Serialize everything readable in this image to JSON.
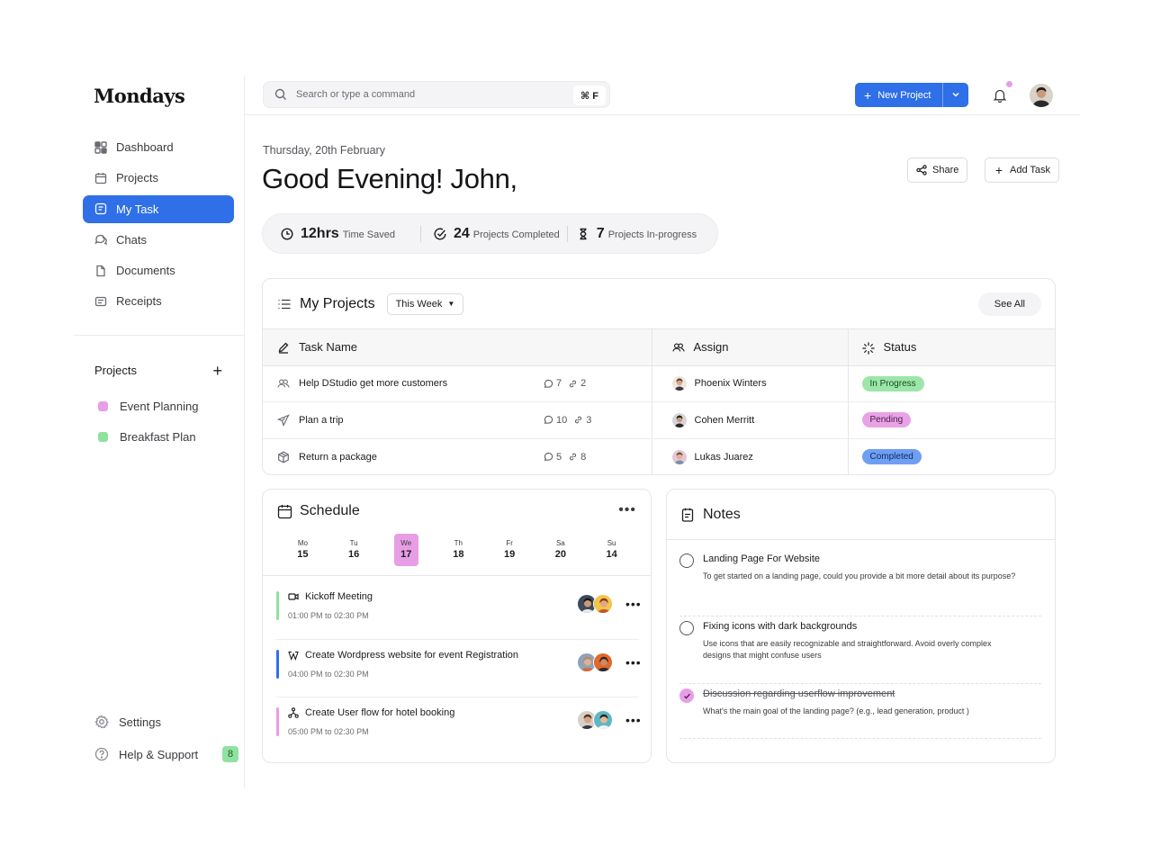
{
  "app": {
    "logo": "Mondays"
  },
  "sidebar": {
    "nav": [
      {
        "label": "Dashboard",
        "icon": "dashboard-icon"
      },
      {
        "label": "Projects",
        "icon": "calendar-icon"
      },
      {
        "label": "My Task",
        "icon": "task-icon",
        "active": true
      },
      {
        "label": "Chats",
        "icon": "chat-icon"
      },
      {
        "label": "Documents",
        "icon": "document-icon"
      },
      {
        "label": "Receipts",
        "icon": "receipt-icon"
      }
    ],
    "projects_heading": "Projects",
    "projects": [
      {
        "label": "Event Planning",
        "color": "#e79ee6"
      },
      {
        "label": "Breakfast Plan",
        "color": "#8fe2a0"
      }
    ],
    "settings_label": "Settings",
    "help_label": "Help & Support",
    "help_count": "8"
  },
  "topbar": {
    "search_placeholder": "Search or type a command",
    "search_shortcut": "⌘ F",
    "new_project_label": "New Project"
  },
  "header": {
    "date": "Thursday, 20th February",
    "greeting": "Good Evening! John,",
    "share_label": "Share",
    "add_task_label": "Add Task"
  },
  "stats": [
    {
      "value": "12hrs",
      "label": "Time Saved",
      "icon": "clock-icon"
    },
    {
      "value": "24",
      "label": "Projects Completed",
      "icon": "check-circle-icon"
    },
    {
      "value": "7",
      "label": "Projects In-progress",
      "icon": "hourglass-icon"
    }
  ],
  "my_projects": {
    "title": "My Projects",
    "range": "This Week",
    "see_all": "See All",
    "columns": {
      "task": "Task Name",
      "assign": "Assign",
      "status": "Status"
    },
    "rows": [
      {
        "task": "Help DStudio get more customers",
        "icon": "users-icon",
        "comments": "7",
        "links": "2",
        "assignee": "Phoenix Winters",
        "status": "In Progress",
        "status_bg": "#9be6a8",
        "status_fg": "#1c4a26"
      },
      {
        "task": "Plan a trip",
        "icon": "plane-icon",
        "comments": "10",
        "links": "3",
        "assignee": "Cohen Merritt",
        "status": "Pending",
        "status_bg": "#eaa2e6",
        "status_fg": "#4a1a48"
      },
      {
        "task": "Return a package",
        "icon": "package-icon",
        "comments": "5",
        "links": "8",
        "assignee": "Lukas Juarez",
        "status": "Completed",
        "status_bg": "#6f9ff3",
        "status_fg": "#0f2a5e"
      }
    ]
  },
  "schedule": {
    "title": "Schedule",
    "days": [
      {
        "name": "Mo",
        "num": "15"
      },
      {
        "name": "Tu",
        "num": "16"
      },
      {
        "name": "We",
        "num": "17",
        "active": true
      },
      {
        "name": "Th",
        "num": "18"
      },
      {
        "name": "Fr",
        "num": "19"
      },
      {
        "name": "Sa",
        "num": "20"
      },
      {
        "name": "Su",
        "num": "14"
      }
    ],
    "events": [
      {
        "title": "Kickoff Meeting",
        "start": "01:00 PM",
        "end": "02:30 PM",
        "color": "#8fe2a0",
        "icon": "video-icon"
      },
      {
        "title": "Create Wordpress website for event Registration",
        "start": "04:00 PM",
        "end": "02:30 PM",
        "color": "#2f6fe8",
        "icon": "wordpress-icon"
      },
      {
        "title": "Create User flow for hotel booking",
        "start": "05:00 PM",
        "end": "02:30 PM",
        "color": "#e79ee6",
        "icon": "flow-icon"
      }
    ],
    "time_separator": "to"
  },
  "notes": {
    "title": "Notes",
    "items": [
      {
        "title": "Landing Page For Website",
        "body": "To get started on a landing page, could you provide a bit more detail about its purpose?",
        "done": false
      },
      {
        "title": "Fixing icons with dark backgrounds",
        "body": "Use icons that are easily recognizable and straightforward. Avoid overly complex designs that might confuse users",
        "done": false
      },
      {
        "title": "Discussion regarding userflow improvement",
        "body": "What's the main goal of the landing page? (e.g., lead generation, product )",
        "done": true
      }
    ]
  }
}
